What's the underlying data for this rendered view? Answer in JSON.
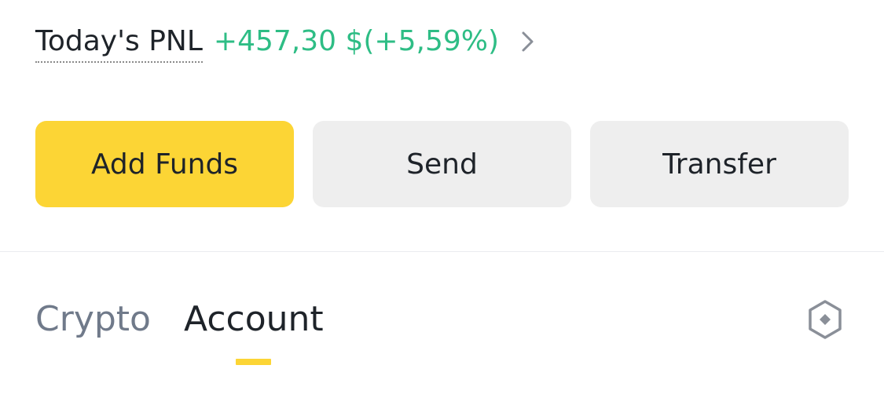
{
  "pnl": {
    "label": "Today's PNL",
    "value": "+457,30 $(+5,59%)",
    "value_color": "#2ebd85",
    "chevron_icon": "chevron-right-icon"
  },
  "actions": {
    "add_funds_label": "Add Funds",
    "send_label": "Send",
    "transfer_label": "Transfer",
    "primary_color": "#fcd535",
    "secondary_color": "#eeeeee"
  },
  "tabs": {
    "items": [
      {
        "label": "Crypto",
        "active": false
      },
      {
        "label": "Account",
        "active": true
      }
    ],
    "indicator_color": "#fcd535",
    "settings_icon": "hexagon-icon"
  }
}
